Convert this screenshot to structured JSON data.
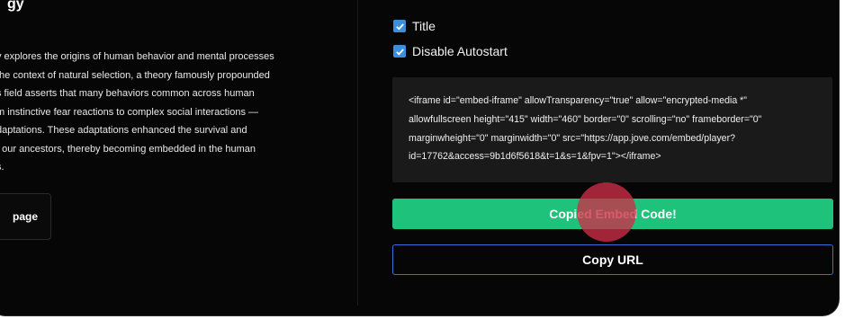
{
  "left_panel": {
    "heading_fragment": "gy",
    "description_lines": [
      "y explores the origins of human behavior and mental processes",
      " the context of natural selection, a theory famously propounded",
      "s field asserts that many behaviors common across human",
      "m instinctive fear reactions to complex social interactions —",
      "daptations. These adaptations enhanced the survival and",
      "f our ancestors, thereby becoming embedded in the human",
      "s."
    ],
    "page_button_label": "page"
  },
  "options": {
    "title_label": "Title",
    "title_checked": true,
    "disable_autostart_label": "Disable Autostart",
    "disable_autostart_checked": true
  },
  "embed_code_lines": [
    "<iframe id=\"embed-iframe\" allowTransparency=\"true\" allow=\"encrypted-media *\"",
    "allowfullscreen height=\"415\" width=\"460\" border=\"0\" scrolling=\"no\" frameborder=\"0\"",
    "marginwheight=\"0\" marginwidth=\"0\" src=\"https://app.jove.com/embed/player?",
    "id=17762&access=9b1d6f5618&t=1&s=1&fpv=1\"></iframe>"
  ],
  "buttons": {
    "copy_embed_label": "Copied Embed Code!",
    "copy_url_label": "Copy URL"
  },
  "colors": {
    "background": "#060606",
    "accent_green": "#1ec27a",
    "checkbox_blue": "#3b8fdc",
    "url_border": "#3a6fd8",
    "code_bg": "#1a1a1a"
  },
  "icons": {
    "checkbox": "checkmark-icon"
  }
}
